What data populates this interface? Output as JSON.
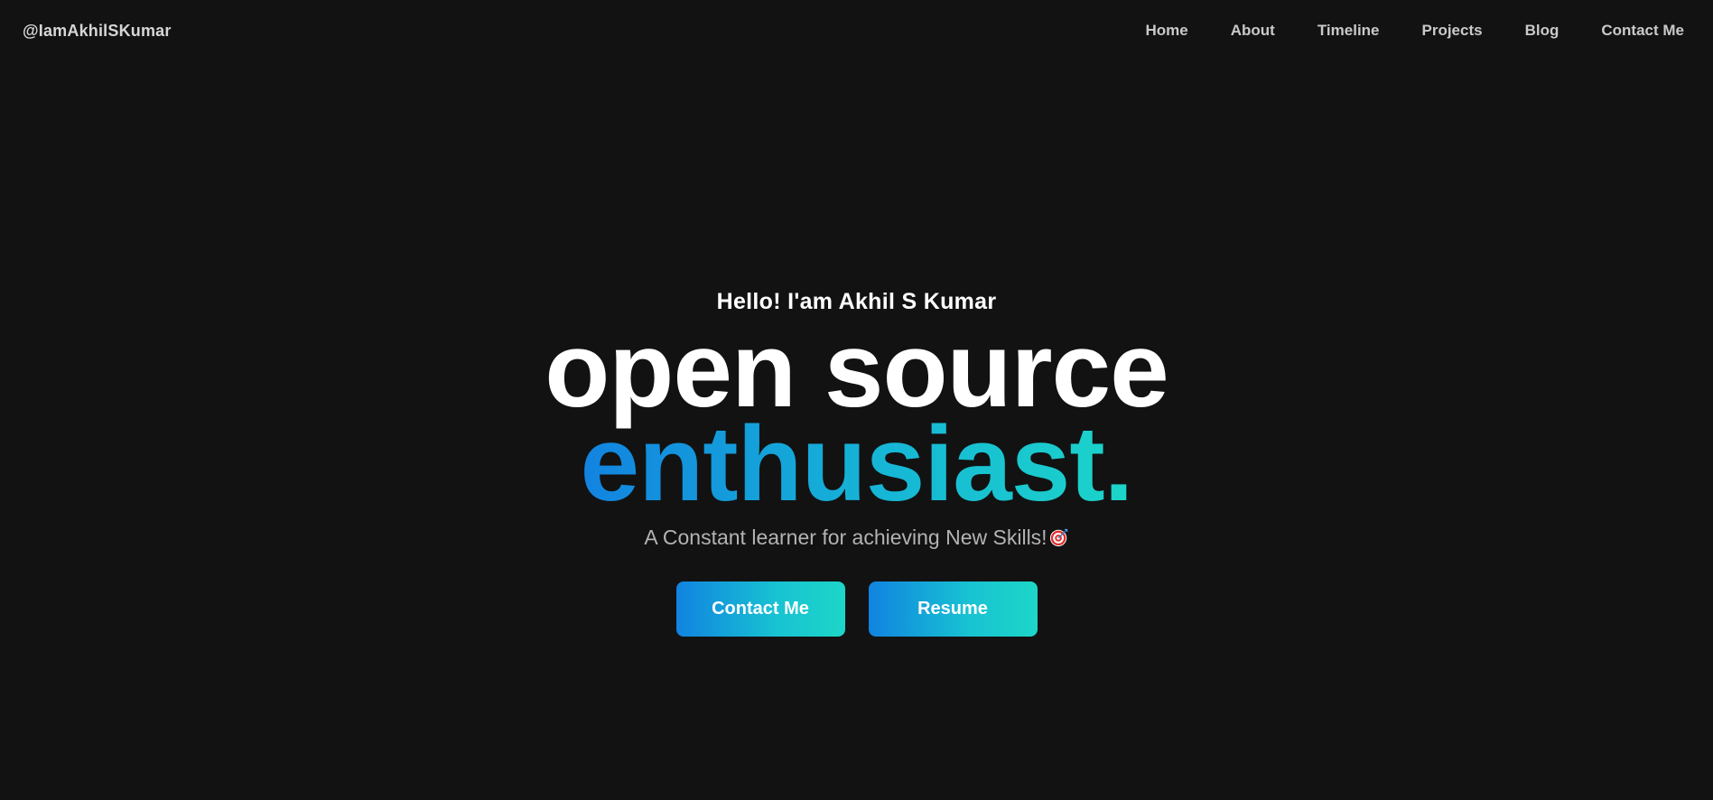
{
  "header": {
    "brand": "@IamAkhilSKumar",
    "nav": [
      {
        "label": "Home"
      },
      {
        "label": "About"
      },
      {
        "label": "Timeline"
      },
      {
        "label": "Projects"
      },
      {
        "label": "Blog"
      },
      {
        "label": "Contact Me"
      }
    ]
  },
  "hero": {
    "greeting": "Hello! I'am Akhil S Kumar",
    "headline_line1": "open source",
    "headline_line2": "enthusiast.",
    "tagline": "A Constant learner for achieving New Skills!",
    "tagline_icon": "direct-hit-target-icon",
    "buttons": {
      "contact_label": "Contact Me",
      "resume_label": "Resume"
    }
  },
  "colors": {
    "background": "#121212",
    "accent_start": "#1283e0",
    "accent_end": "#1cd5c9"
  }
}
